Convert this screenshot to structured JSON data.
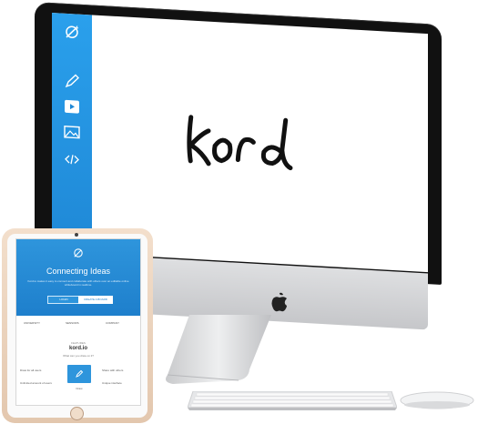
{
  "imac": {
    "screen_logo": "korд",
    "sidebar_icons": [
      "kord-logo-icon",
      "pen-icon",
      "video-icon",
      "image-icon",
      "code-icon"
    ]
  },
  "ipad": {
    "hero_title": "Connecting Ideas",
    "hero_subtitle": "Kord.io makes it easy to connect and collaborate with others over an editable online whiteboard in realtime.",
    "login_label": "LOGIN",
    "create_label": "CREATE A BOARD",
    "partners": [
      "UNIVERSITY",
      "SENSORS",
      "COMPANY"
    ],
    "section_small": "FEATURES",
    "section_title": "kord.io",
    "section_subtitle": "What can you draw on it?",
    "features": {
      "left_1": "Draw for all users",
      "left_2": "Unlimited amount of users",
      "right_1": "Share with others",
      "right_2": "Unique interface",
      "card_label": "Draw"
    }
  },
  "colors": {
    "accent_blue": "#1f88d6",
    "hero_blue": "#2e95dc"
  }
}
